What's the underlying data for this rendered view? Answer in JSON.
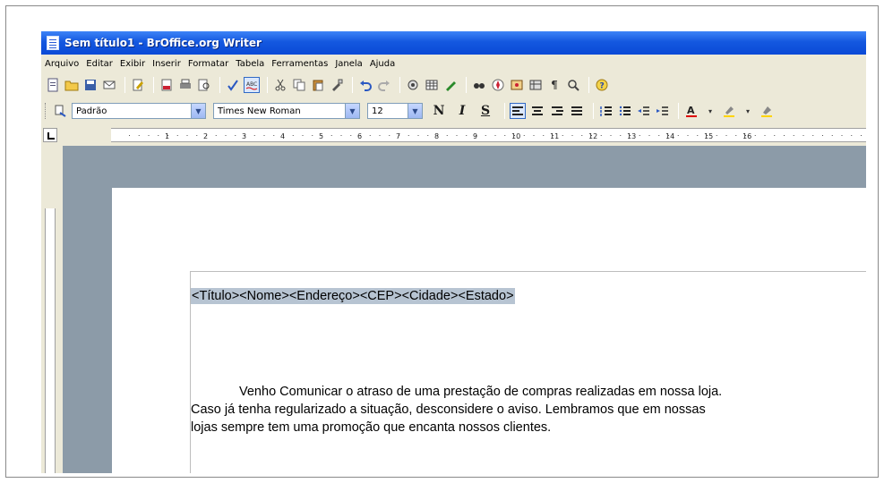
{
  "window": {
    "title": "Sem título1 - BrOffice.org Writer"
  },
  "menu": [
    "Arquivo",
    "Editar",
    "Exibir",
    "Inserir",
    "Formatar",
    "Tabela",
    "Ferramentas",
    "Janela",
    "Ajuda"
  ],
  "toolbar_icons": [
    "new-icon",
    "open-icon",
    "save-icon",
    "email-icon",
    "edit-icon",
    "pdf-icon",
    "print-icon",
    "preview-icon",
    "spellcheck-icon",
    "autospell-icon",
    "cut-icon",
    "copy-icon",
    "paste-icon",
    "format-paint-icon",
    "undo-icon",
    "redo-icon",
    "hyperlink-icon",
    "table-icon",
    "draw-icon",
    "find-icon",
    "navigator-icon",
    "gallery-icon",
    "datasource-icon",
    "nonprinting-icon",
    "zoom-icon",
    "help-icon"
  ],
  "format": {
    "style": "Padrão",
    "font": "Times New Roman",
    "size": "12",
    "bold": "N",
    "italic": "I",
    "underline": "S"
  },
  "ruler_numbers": [
    "1",
    "2",
    "3",
    "4",
    "5",
    "6",
    "7",
    "8",
    "9",
    "10",
    "11",
    "12",
    "13",
    "14",
    "15",
    "16"
  ],
  "document": {
    "header_fields": "<Título><Nome><Endereço><CEP><Cidade><Estado>",
    "body_lines": [
      "Venho Comunicar o atraso de uma prestação de compras realizadas em nossa loja.",
      "Caso já tenha regularizado a situação, desconsidere o aviso. Lembramos que em nossas",
      "lojas sempre tem uma promoção que encanta nossos clientes."
    ]
  },
  "colors": {
    "titlebar": "#1458e0",
    "workspace": "#8c9ba8",
    "selection": "#b7c4d2"
  }
}
